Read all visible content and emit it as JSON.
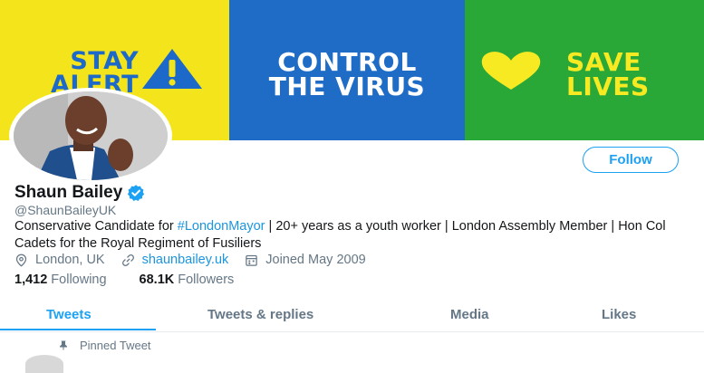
{
  "banner": {
    "stay_line1": "STAY",
    "stay_line2": "ALERT",
    "control_line1": "CONTROL",
    "control_line2": "THE VIRUS",
    "save_line1": "SAVE",
    "save_line2": "LIVES",
    "colors": {
      "yellow": "#f4e41c",
      "blue": "#1f6cc7",
      "green": "#29a838"
    }
  },
  "profile": {
    "name": "Shaun Bailey",
    "handle": "@ShaunBaileyUK",
    "verified": true,
    "bio_part1": "Conservative Candidate for ",
    "bio_hashtag": "#LondonMayor",
    "bio_part2": " | 20+ years as a youth worker | London Assembly Member | Hon Col Cadets for the Royal Regiment of Fusiliers",
    "location": "London, UK",
    "website": "shaunbailey.uk",
    "joined": "Joined May 2009",
    "following_count": "1,412",
    "following_label": "Following",
    "followers_count": "68.1K",
    "followers_label": "Followers"
  },
  "actions": {
    "follow_label": "Follow"
  },
  "tabs": [
    {
      "label": "Tweets",
      "active": true
    },
    {
      "label": "Tweets & replies",
      "active": false
    },
    {
      "label": "Media",
      "active": false
    },
    {
      "label": "Likes",
      "active": false
    }
  ],
  "pinned_label": "Pinned Tweet",
  "icons": {
    "warning": "warning-triangle-icon",
    "heart": "heart-icon",
    "verified": "verified-badge-icon",
    "location": "location-pin-icon",
    "link": "link-icon",
    "calendar": "calendar-icon",
    "pin": "pin-icon"
  },
  "accent_color": "#1da1f2"
}
